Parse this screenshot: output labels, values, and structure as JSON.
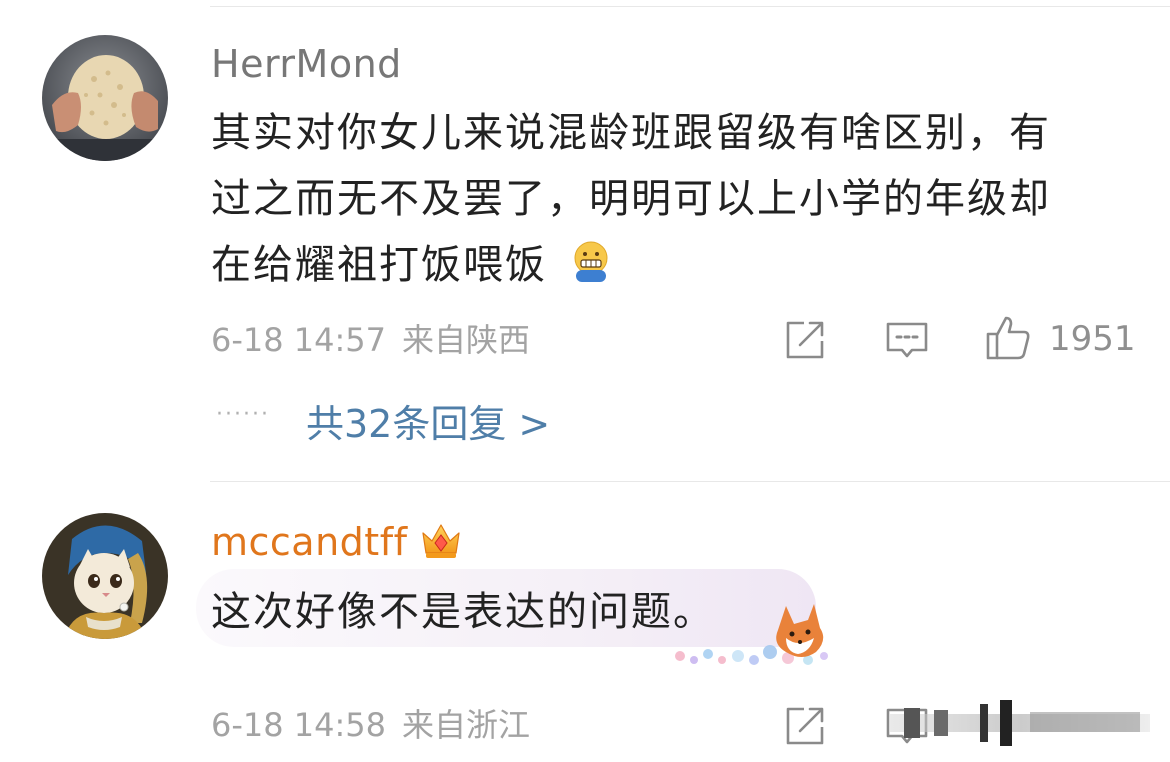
{
  "comments": [
    {
      "username": "HerrMond",
      "avatar": "hand-holding-cracker-avatar",
      "text_lines": [
        "其实对你女儿来说混龄班跟留级有啥区别，有",
        "过之而无不及罢了，明明可以上小学的年级却",
        "在给耀祖打饭喂饭"
      ],
      "emoji": "grimace-face-emoji",
      "date": "6-18 14:57",
      "location": "来自陕西",
      "like_count": "1951",
      "replies_label": "共32条回复 >"
    },
    {
      "username": "mccandtff",
      "avatar": "cat-with-pearl-earring-avatar",
      "badge": "crown-badge-icon",
      "text": "这次好像不是表达的问题。",
      "date": "6-18 14:58",
      "location": "来自浙江"
    }
  ],
  "icons": {
    "share": "share-icon",
    "comment": "comment-icon",
    "like": "thumbs-up-icon"
  },
  "colors": {
    "username": "#777777",
    "vip_username": "#e0761c",
    "reply_link": "#4f7ea8",
    "text": "#222222",
    "meta": "#a3a3a3"
  }
}
